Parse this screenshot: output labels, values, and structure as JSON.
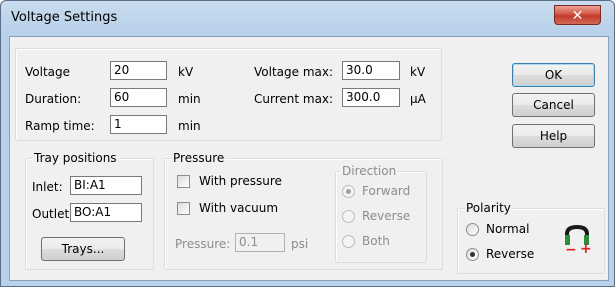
{
  "window": {
    "title": "Voltage Settings",
    "close_glyph": "✕"
  },
  "settings": {
    "voltage_label": "Voltage",
    "voltage_value": "20",
    "voltage_unit": "kV",
    "duration_label": "Duration:",
    "duration_value": "60",
    "duration_unit": "min",
    "ramp_label": "Ramp time:",
    "ramp_value": "1",
    "ramp_unit": "min",
    "vmax_label": "Voltage max:",
    "vmax_value": "30.0",
    "vmax_unit": "kV",
    "cmax_label": "Current max:",
    "cmax_value": "300.0",
    "cmax_unit": "μA"
  },
  "buttons": {
    "ok": "OK",
    "cancel": "Cancel",
    "help": "Help",
    "trays": "Trays..."
  },
  "tray": {
    "legend": "Tray positions",
    "inlet_label": "Inlet:",
    "inlet_value": "BI:A1",
    "outlet_label": "Outlet:",
    "outlet_value": "BO:A1"
  },
  "pressure": {
    "legend": "Pressure",
    "with_pressure": "With pressure",
    "with_vacuum": "With vacuum",
    "pressure_label": "Pressure:",
    "pressure_value": "0.1",
    "pressure_unit": "psi",
    "direction_legend": "Direction",
    "forward": "Forward",
    "reverse": "Reverse",
    "both": "Both",
    "selected_direction": "Forward"
  },
  "polarity": {
    "legend": "Polarity",
    "normal": "Normal",
    "reverse": "Reverse",
    "selected": "Reverse",
    "icon": "polarity-reverse-icon",
    "minus": "−",
    "plus": "+"
  },
  "colors": {
    "minus": "#e0201c",
    "plus": "#e0201c",
    "electrode": "#2c8c3c"
  }
}
